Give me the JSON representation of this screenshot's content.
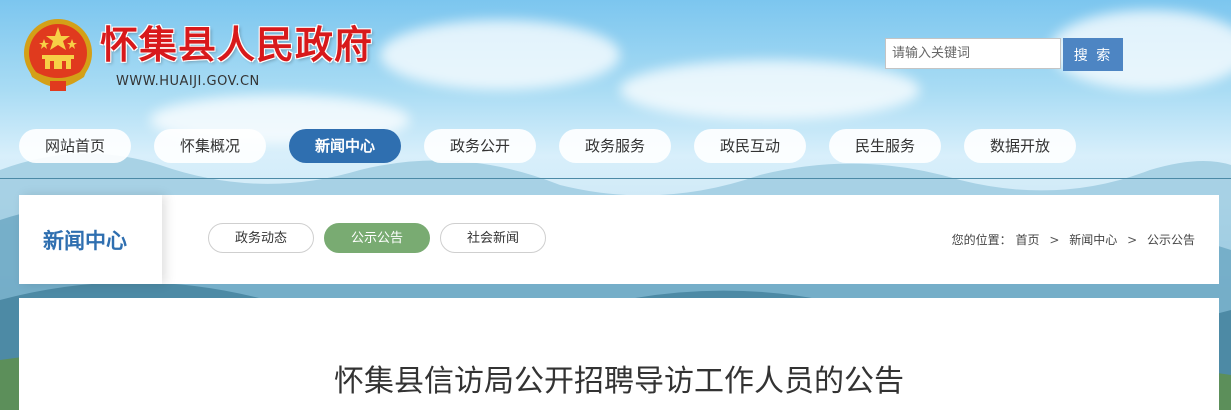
{
  "header": {
    "site_title": "怀集县人民政府",
    "site_url": "WWW.HUAIJI.GOV.CN",
    "emblem_icon": "national-emblem-icon"
  },
  "search": {
    "placeholder": "请输入关键词",
    "button_label": "搜 索"
  },
  "nav": {
    "items": [
      {
        "label": "网站首页",
        "active": false
      },
      {
        "label": "怀集概况",
        "active": false
      },
      {
        "label": "新闻中心",
        "active": true
      },
      {
        "label": "政务公开",
        "active": false
      },
      {
        "label": "政务服务",
        "active": false
      },
      {
        "label": "政民互动",
        "active": false
      },
      {
        "label": "民生服务",
        "active": false
      },
      {
        "label": "数据开放",
        "active": false
      }
    ]
  },
  "section": {
    "title": "新闻中心",
    "tabs": [
      {
        "label": "政务动态",
        "active": false
      },
      {
        "label": "公示公告",
        "active": true
      },
      {
        "label": "社会新闻",
        "active": false
      }
    ]
  },
  "breadcrumb": {
    "prefix": "您的位置：",
    "items": [
      "首页",
      "新闻中心",
      "公示公告"
    ],
    "separator": ">"
  },
  "article": {
    "title": "怀集县信访局公开招聘导访工作人员的公告"
  },
  "colors": {
    "accent_blue": "#2f6fb0",
    "active_tab_green": "#79ab72",
    "title_red": "#d8191b",
    "search_button": "#4d85c3"
  }
}
